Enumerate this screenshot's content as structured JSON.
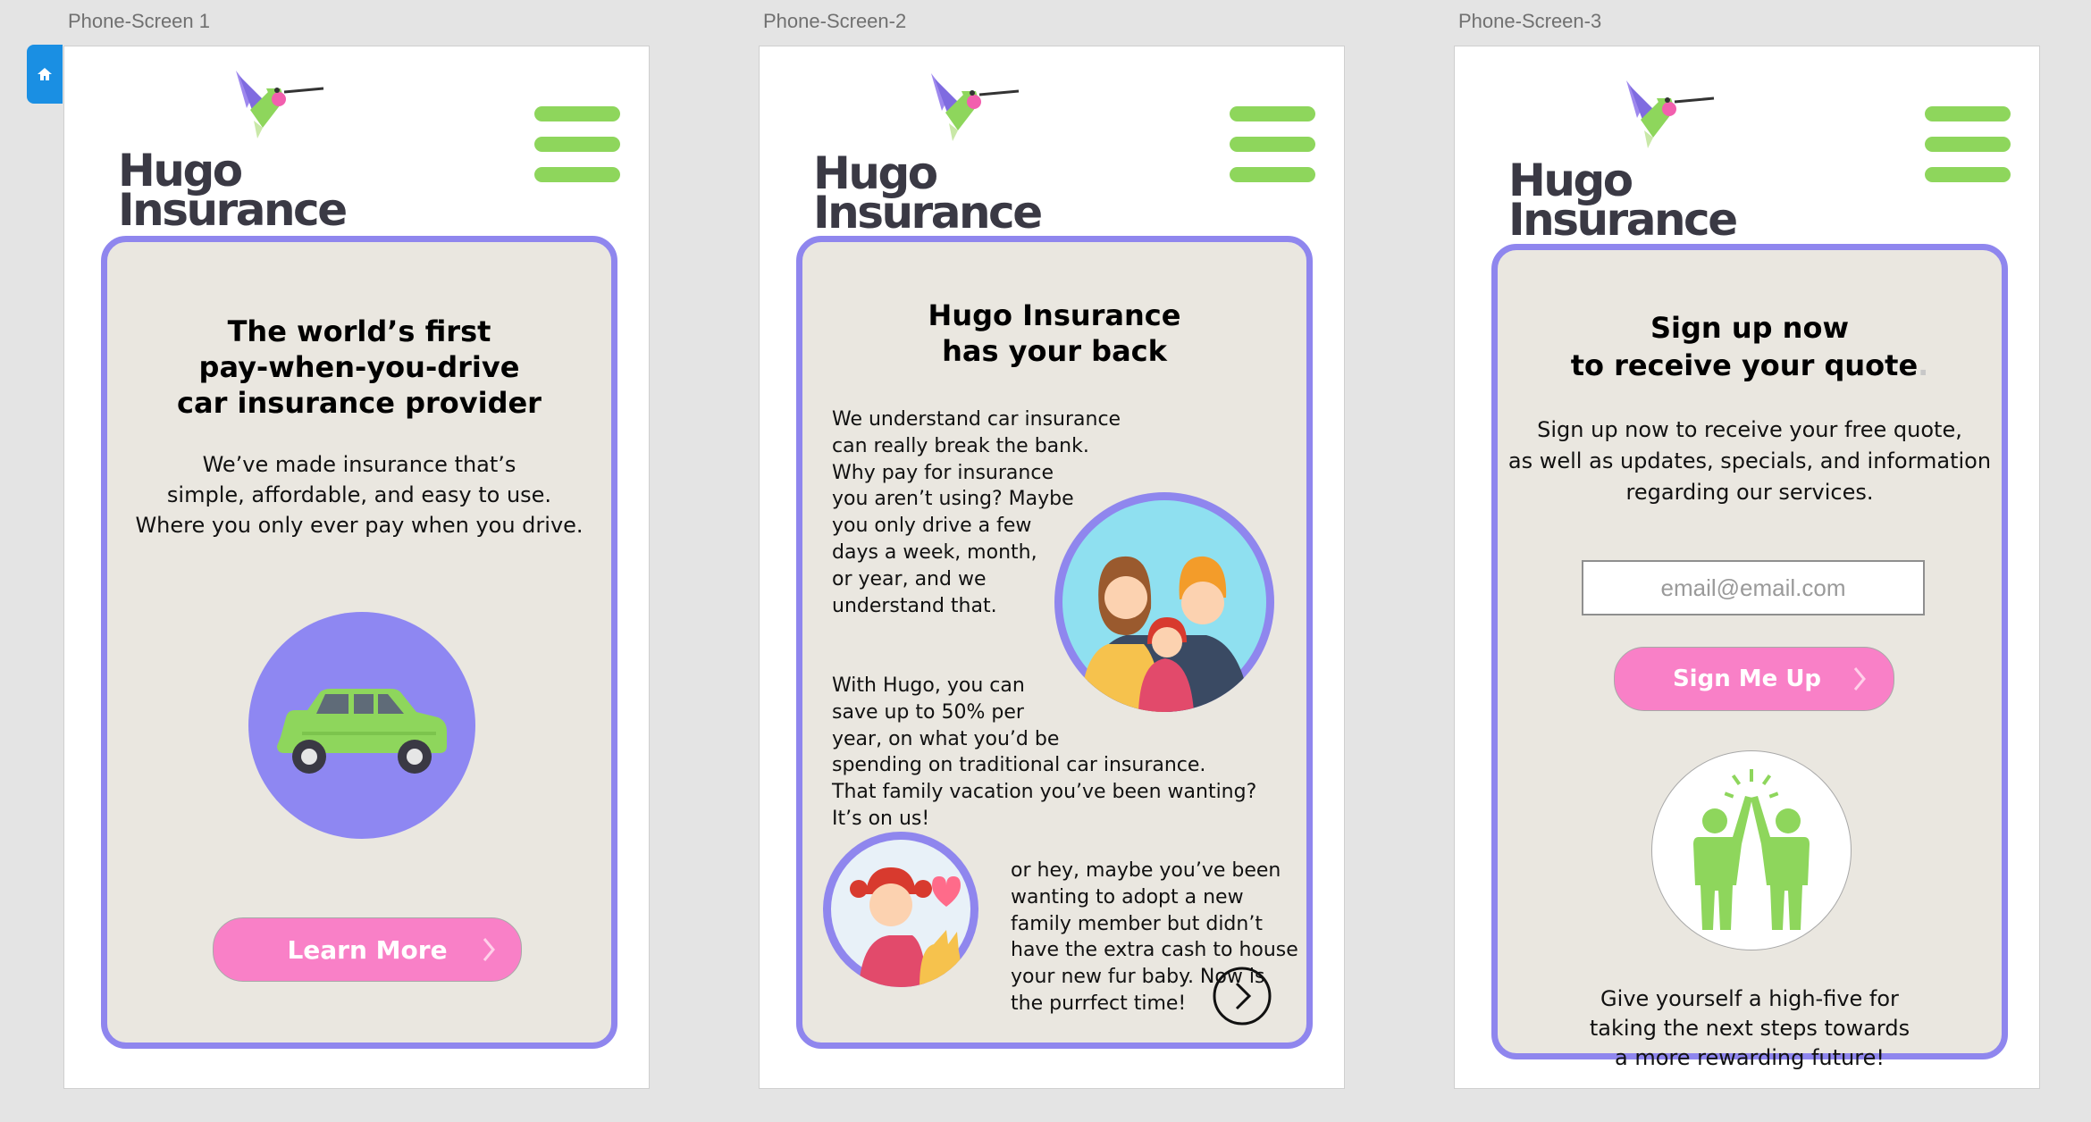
{
  "artboards": [
    {
      "label": "Phone-Screen 1"
    },
    {
      "label": "Phone-Screen-2"
    },
    {
      "label": "Phone-Screen-3"
    }
  ],
  "brand": {
    "logo_line1": "Hugo",
    "logo_line2": "Insurance"
  },
  "screen1": {
    "heading": [
      "The world’s first",
      "pay-when-you-drive",
      "car insurance provider"
    ],
    "body": [
      "We’ve made insurance that’s",
      "simple, affordable, and easy to use.",
      "Where you only ever pay when you drive."
    ],
    "button": "Learn More"
  },
  "screen2": {
    "heading": [
      "Hugo Insurance",
      "has your back"
    ],
    "para1": [
      "We understand car insurance",
      "can really break the bank.",
      "Why pay for insurance",
      "you aren’t using? Maybe",
      "you only drive a few",
      "days a week, month,",
      "or year, and we",
      "understand that."
    ],
    "para2": [
      "With Hugo, you can",
      "save up to 50% per",
      "year, on what you’d be",
      "spending on traditional car insurance.",
      "That family vacation you’ve been wanting?",
      "It’s on us!"
    ],
    "para3": [
      "or hey, maybe you’ve been",
      "wanting to adopt a new",
      "family member but didn’t",
      "have the extra cash to house",
      "your new fur baby. Now is",
      "the purrfect time!"
    ]
  },
  "screen3": {
    "heading": [
      "Sign up now",
      "to receive your quote"
    ],
    "heading_dot": ".",
    "body": [
      "Sign up now to receive your free quote,",
      "as well as updates, specials, and information",
      "regarding our services."
    ],
    "email_placeholder": "email@email.com",
    "button": "Sign Me Up",
    "footer": [
      "Give yourself a high-five for",
      "taking the next steps towards",
      "a more rewarding future!"
    ]
  },
  "colors": {
    "card_border": "#8f86ee",
    "card_bg": "#eae7e0",
    "menu_green": "#8ed65c",
    "button_pink": "#f980c7",
    "home_tab_blue": "#1a8fe3"
  }
}
